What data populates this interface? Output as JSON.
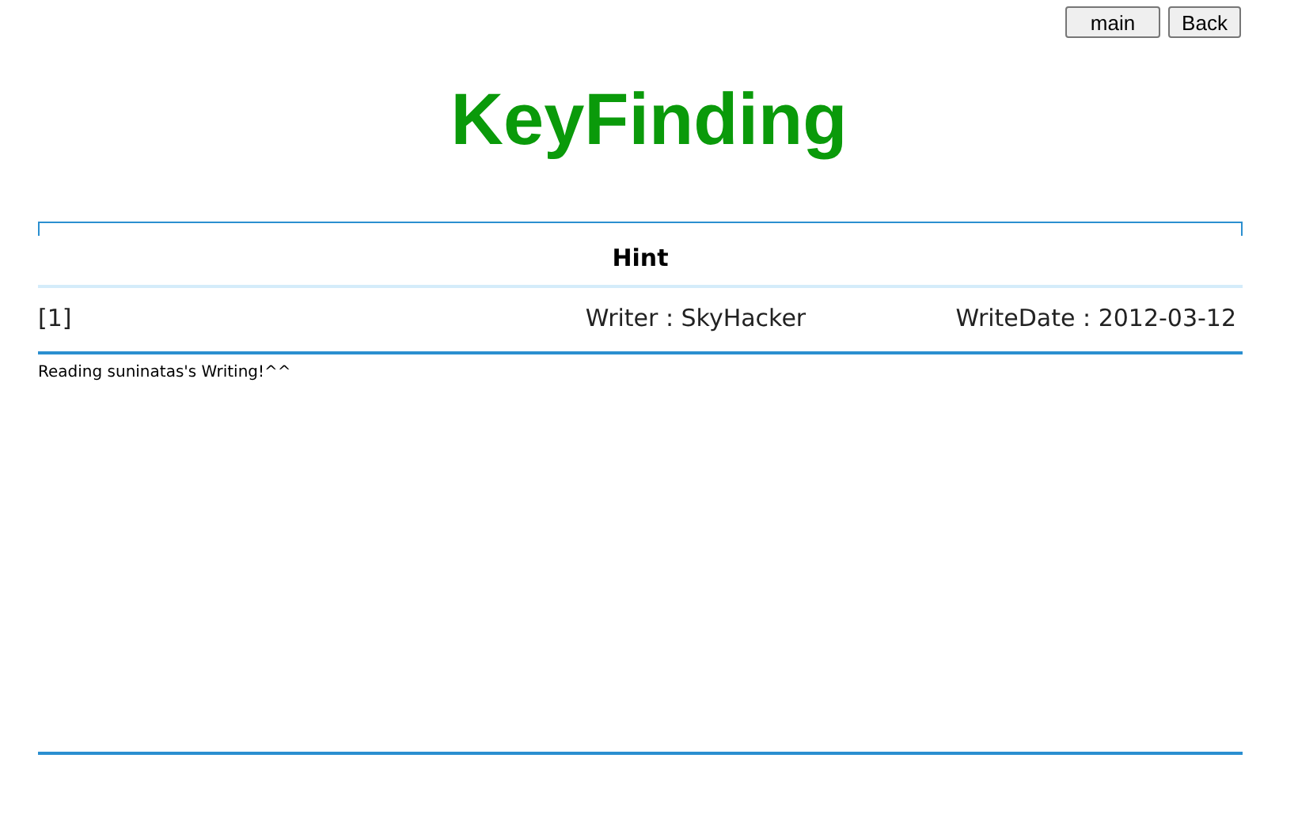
{
  "nav_buttons": [
    "main",
    "Back"
  ],
  "title": "KeyFinding",
  "post": {
    "heading": "Hint",
    "number": "[1]",
    "writer": "Writer : SkyHacker",
    "date": "WriteDate : 2012-03-12",
    "body": "Reading suninatas's Writing!^^"
  }
}
